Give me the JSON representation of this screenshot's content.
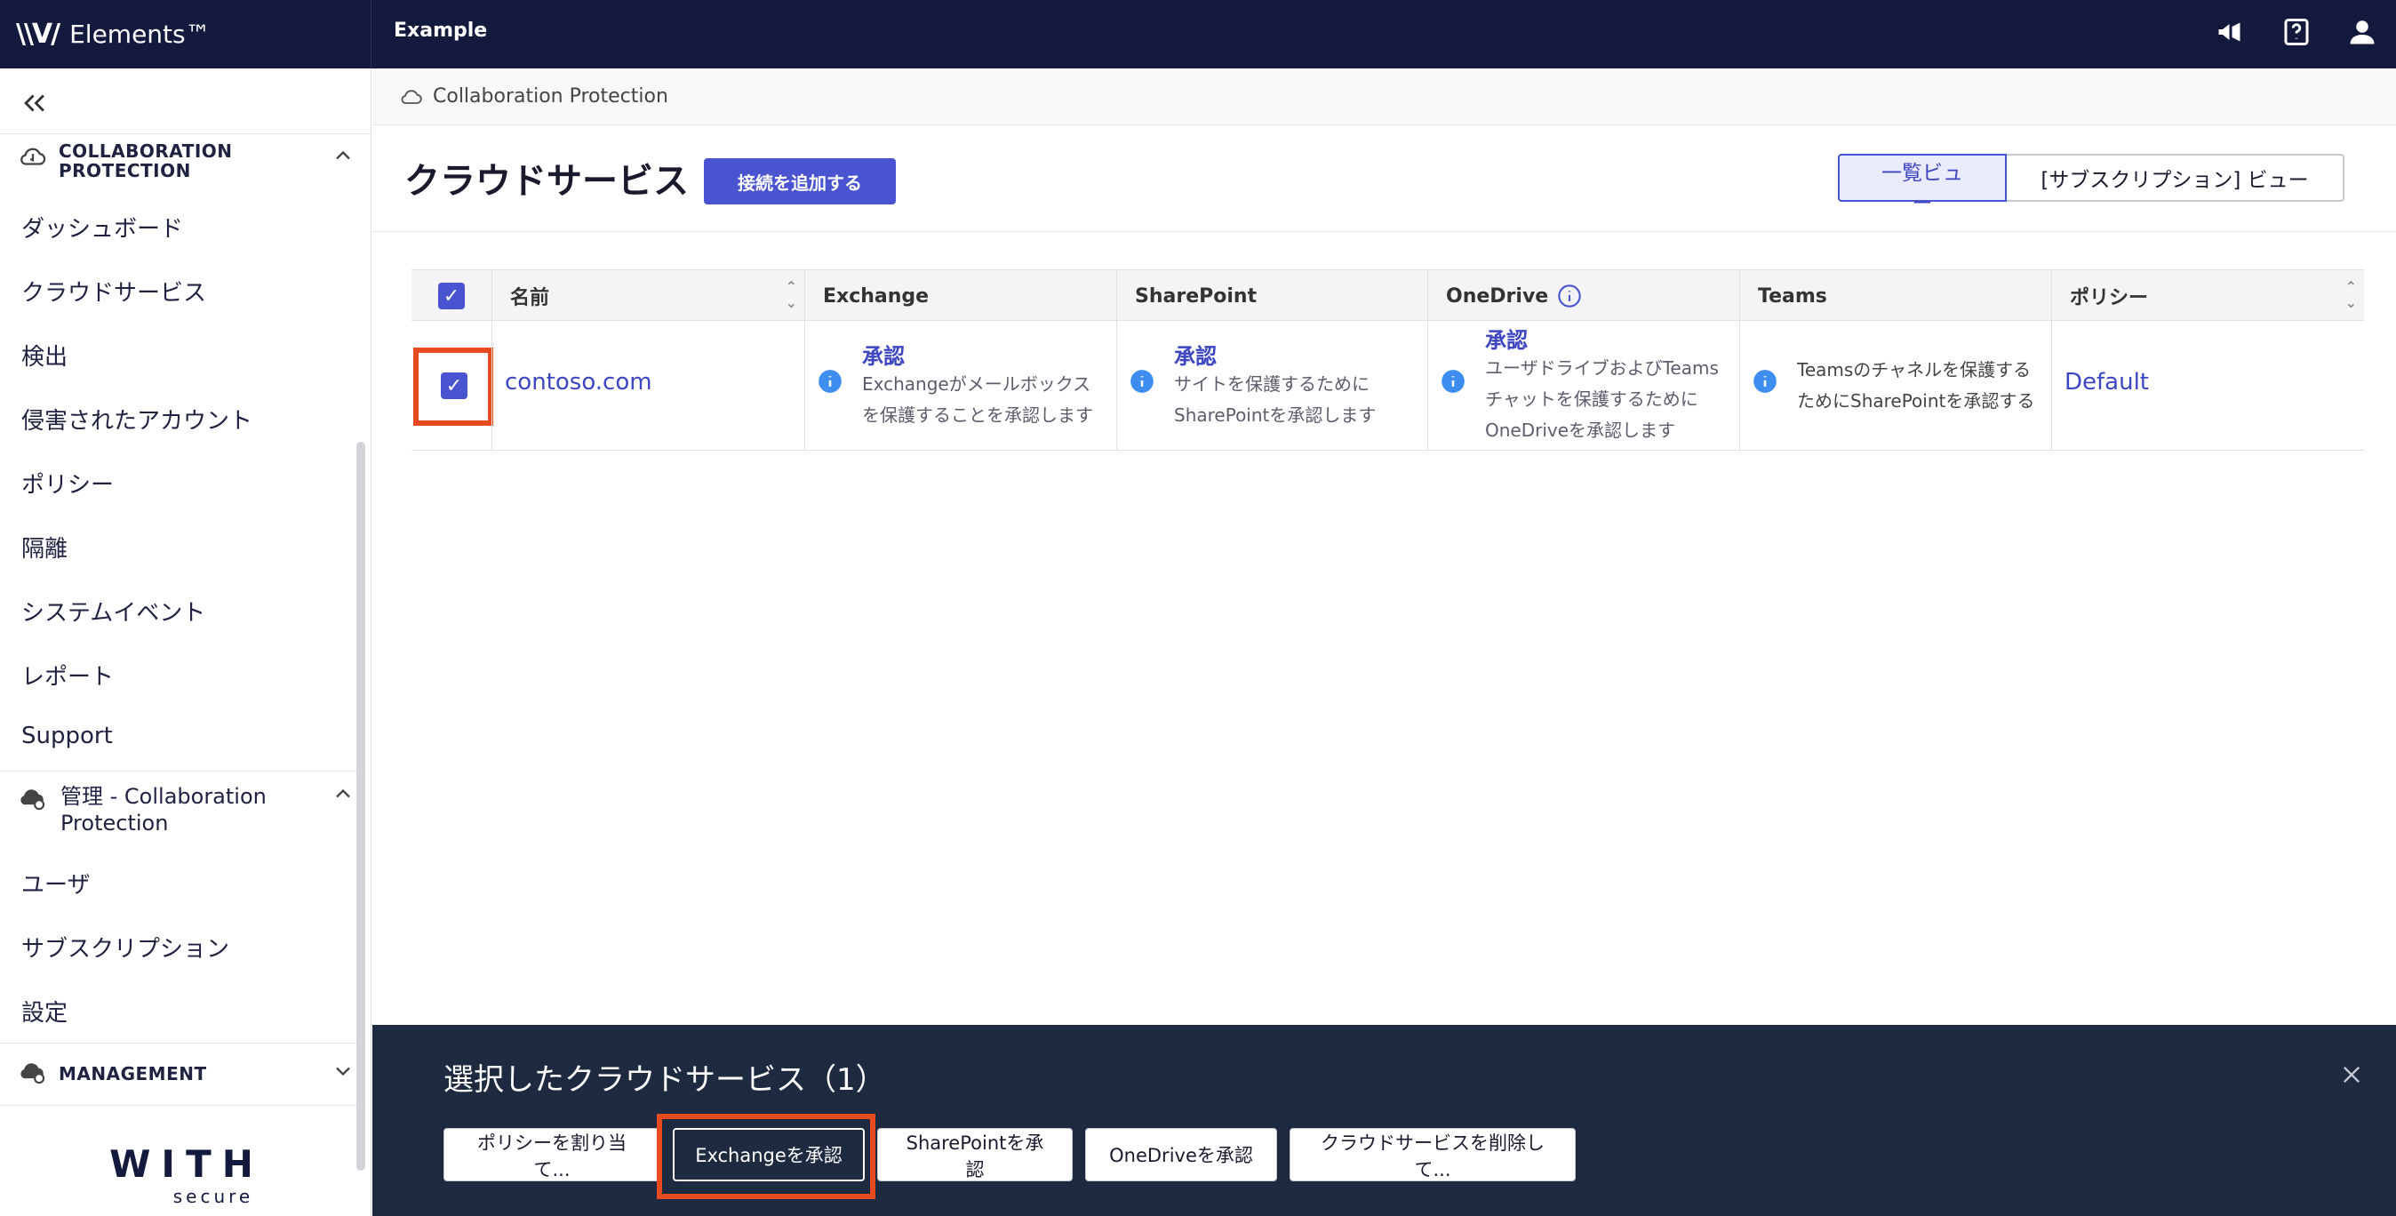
{
  "app": {
    "brand": "Elements™",
    "org": "Example"
  },
  "breadcrumb": {
    "label": "Collaboration Protection"
  },
  "page": {
    "title": "クラウドサービス",
    "add_button": "接続を追加する"
  },
  "views": {
    "list": "一覧ビュー",
    "subscription": "[サブスクリプション] ビュー"
  },
  "sidebar": {
    "section1_title": "COLLABORATION PROTECTION",
    "items": [
      "ダッシュボード",
      "クラウドサービス",
      "検出",
      "侵害されたアカウント",
      "ポリシー",
      "隔離",
      "システムイベント",
      "レポート",
      "Support"
    ],
    "admin_title": "管理 - Collaboration Protection",
    "admin_items": [
      "ユーザ",
      "サブスクリプション",
      "設定"
    ],
    "management_title": "MANAGEMENT",
    "footer_logo": "WITH",
    "footer_logo_sub": "secure"
  },
  "table": {
    "headers": {
      "name": "名前",
      "exchange": "Exchange",
      "sharepoint": "SharePoint",
      "onedrive": "OneDrive",
      "teams": "Teams",
      "policy": "ポリシー"
    },
    "row": {
      "name": "contoso.com",
      "exchange_title": "承認",
      "exchange_desc": "Exchangeがメールボックスを保護することを承認します",
      "sharepoint_title": "承認",
      "sharepoint_desc": "サイトを保護するためにSharePointを承認します",
      "onedrive_title": "承認",
      "onedrive_desc": "ユーザドライブおよびTeamsチャットを保護するためにOneDriveを承認します",
      "teams_desc": "Teamsのチャネルを保護するためにSharePointを承認する",
      "policy": "Default"
    }
  },
  "actionbar": {
    "title": "選択したクラウドサービス（1）",
    "buttons": {
      "assign": "ポリシーを割り当て...",
      "exchange": "Exchangeを承認",
      "sharepoint": "SharePointを承認",
      "onedrive": "OneDriveを承認",
      "delete": "クラウドサービスを削除して..."
    }
  }
}
